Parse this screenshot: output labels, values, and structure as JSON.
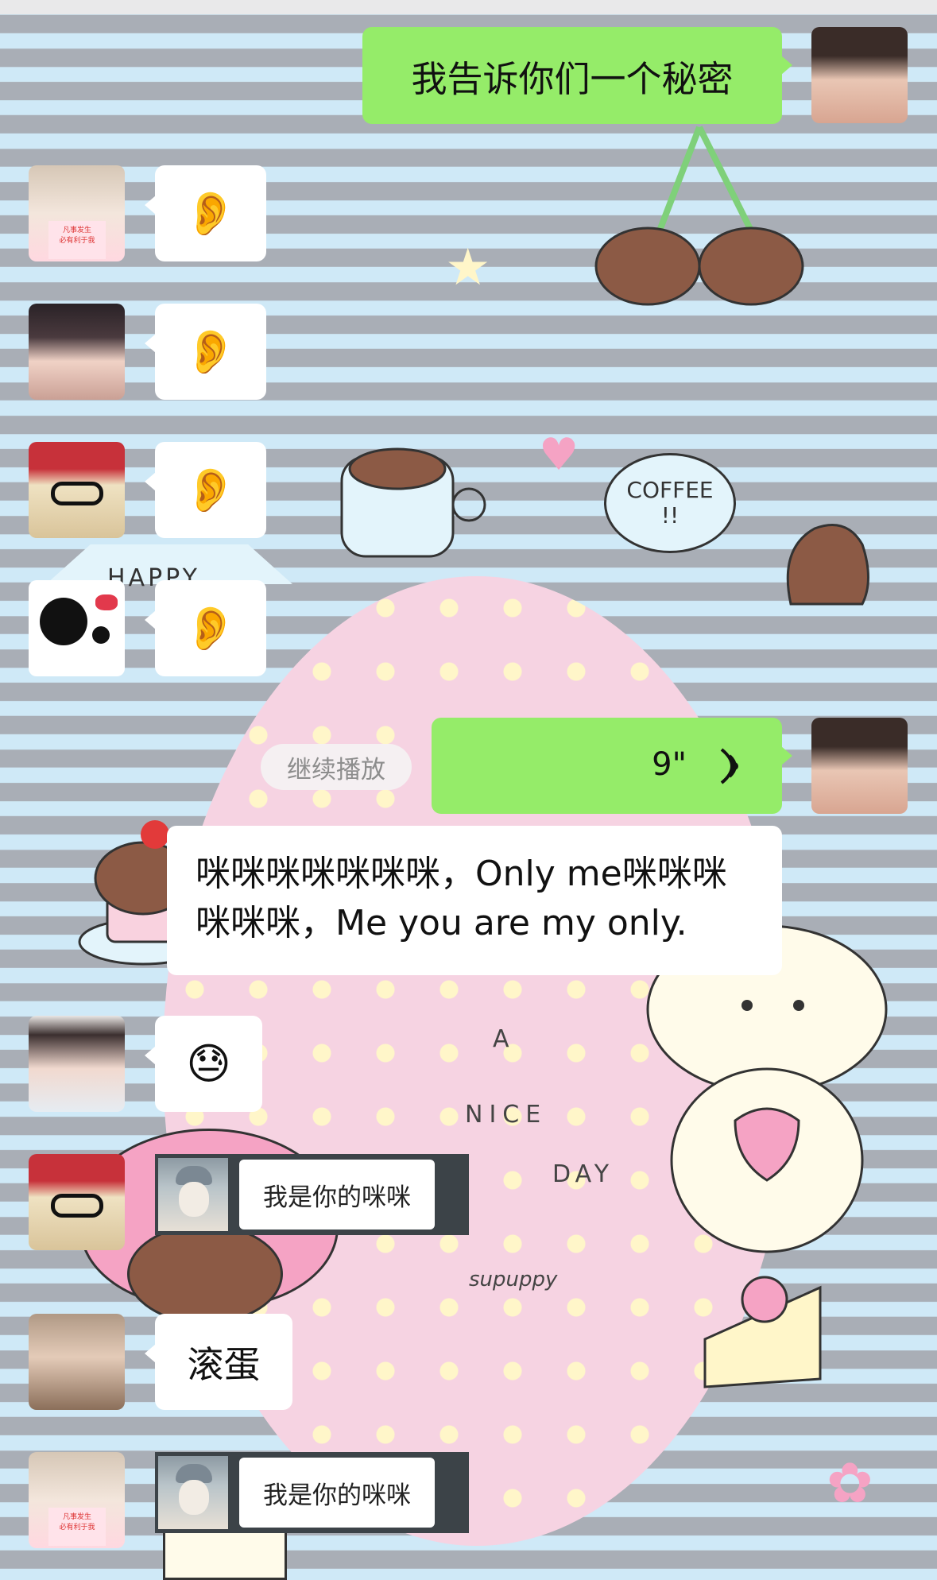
{
  "messages": {
    "m1": {
      "text": "我告诉你们一个秘密"
    },
    "m2": {
      "emoji": "👂"
    },
    "m3": {
      "emoji": "👂"
    },
    "m4": {
      "emoji": "👂"
    },
    "m5": {
      "emoji": "👂"
    },
    "voice": {
      "duration": "9\"",
      "continue_label": "继续播放"
    },
    "m7": {
      "text": "咪咪咪咪咪咪咪，Only me咪咪咪咪咪咪，Me you are my only."
    },
    "m8": {
      "emoji": "😓"
    },
    "m9": {
      "sticker_text": "我是你的咪咪"
    },
    "m10": {
      "text": "滚蛋"
    },
    "m11": {
      "sticker_text": "我是你的咪咪"
    }
  },
  "avatar_cards": {
    "text": "凡事发生\n必有利于我"
  },
  "wallpaper": {
    "coffee_bubble": "COFFEE\n!!",
    "happy_tag": "HAPPY",
    "egg_text": {
      "a": "A",
      "nice": "NICE",
      "day": "DAY",
      "brand": "supuppy"
    }
  },
  "colors": {
    "green_bubble": "#95ec69",
    "white_bubble": "#ffffff",
    "stripe_blue": "#cfe9f7",
    "stripe_gray": "#a9aeb6",
    "egg_pink": "#f6d3e2"
  }
}
